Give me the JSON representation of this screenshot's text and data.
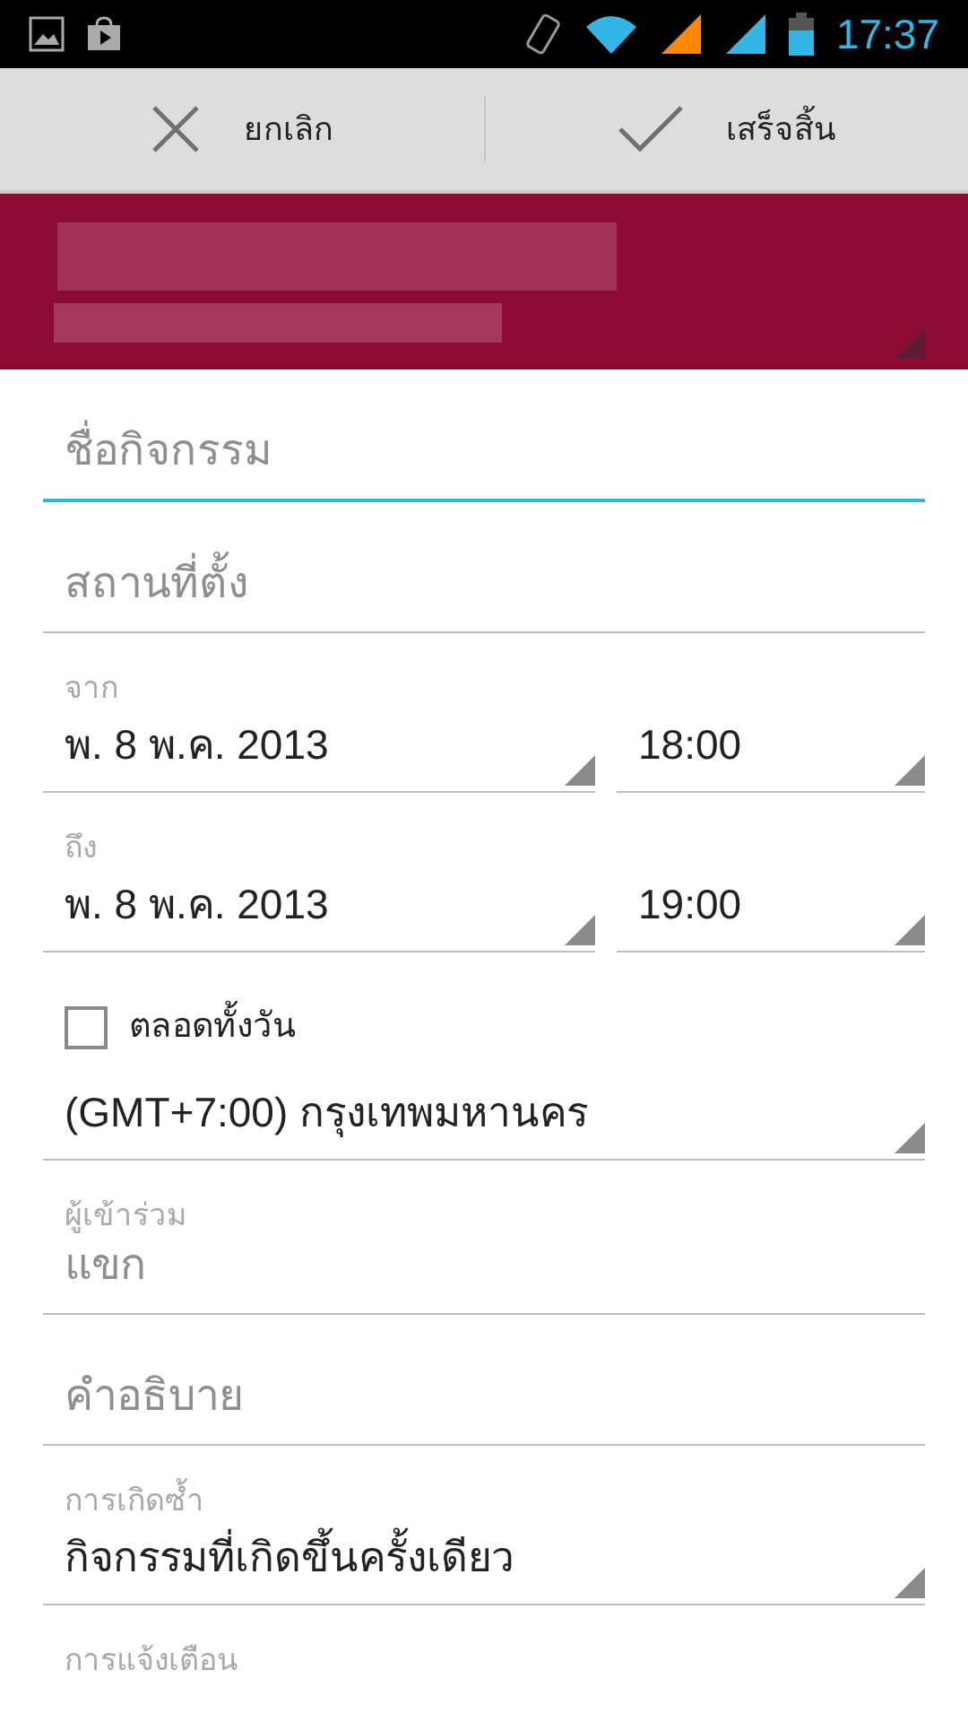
{
  "status_bar": {
    "time": "17:37"
  },
  "action_bar": {
    "buttons": [
      {
        "kind": "cancel",
        "label": "ยกเลิก"
      },
      {
        "kind": "done",
        "label": "เสร็จสิ้น"
      }
    ]
  },
  "form": {
    "title": {
      "placeholder": "ชื่อกิจกรรม",
      "focused": true
    },
    "location": {
      "placeholder": "สถานที่ตั้ง",
      "focused": false
    },
    "from": {
      "label": "จาก",
      "date": "พ. 8 พ.ค. 2013",
      "time": "18:00"
    },
    "to": {
      "label": "ถึง",
      "date": "พ. 8 พ.ค. 2013",
      "time": "19:00"
    },
    "all_day": {
      "label": "ตลอดทั้งวัน",
      "checked": false
    },
    "timezone": {
      "value": "(GMT+7:00) กรุงเทพมหานคร"
    },
    "guests": {
      "label": "ผู้เข้าร่วม",
      "placeholder": "แขก"
    },
    "description": {
      "placeholder": "คำอธิบาย"
    },
    "repeat": {
      "label": "การเกิดซ้ำ",
      "value": "กิจกรรมที่เกิดขึ้นครั้งเดียว"
    },
    "reminders": {
      "label": "การแจ้งเตือน"
    }
  }
}
